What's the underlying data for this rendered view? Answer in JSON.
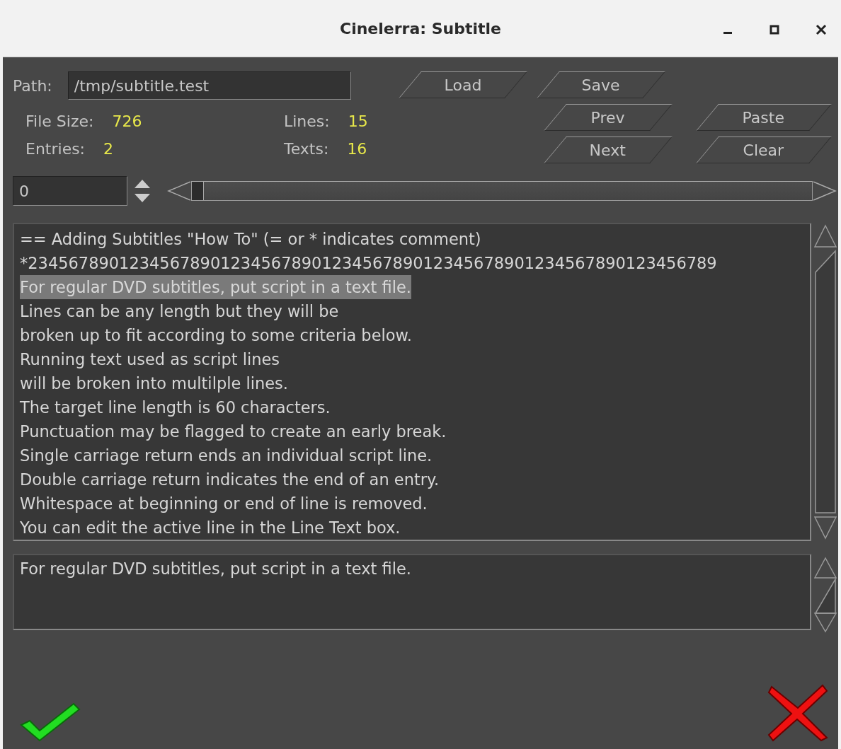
{
  "window": {
    "title": "Cinelerra: Subtitle"
  },
  "path": {
    "label": "Path:",
    "value": "/tmp/subtitle.test"
  },
  "stats": [
    {
      "label": "File Size:",
      "value": "726"
    },
    {
      "label": "Lines:",
      "value": "15"
    },
    {
      "label": "Entries:",
      "value": "2"
    },
    {
      "label": "Texts:",
      "value": "16"
    }
  ],
  "buttons": {
    "load": "Load",
    "save": "Save",
    "prev": "Prev",
    "paste": "Paste",
    "next": "Next",
    "clear": "Clear"
  },
  "position": {
    "value": "0",
    "level": 0
  },
  "script_lines": [
    {
      "text": "== Adding Subtitles \"How To\" (= or * indicates comment)",
      "selected": false
    },
    {
      "text": "*23456789012345678901234567890123456789012345678901234567890123456789",
      "selected": false
    },
    {
      "text": "For regular DVD subtitles, put script in a text file.",
      "selected": true
    },
    {
      "text": "Lines can be any length but they will be",
      "selected": false
    },
    {
      "text": "broken up to fit according to some criteria below.",
      "selected": false
    },
    {
      "text": "Running text used as script lines",
      "selected": false
    },
    {
      "text": "will be broken into multilple lines.",
      "selected": false
    },
    {
      "text": "The target line length is 60 characters.",
      "selected": false
    },
    {
      "text": "Punctuation may be flagged to create an early break.",
      "selected": false
    },
    {
      "text": "Single carriage return ends an individual script line.",
      "selected": false
    },
    {
      "text": "Double carriage return indicates the end of an entry.",
      "selected": false
    },
    {
      "text": "Whitespace at beginning or end of line is removed.",
      "selected": false
    },
    {
      "text": "You can edit the active line in the Line Text box.",
      "selected": false
    }
  ],
  "line_text": {
    "value": "For regular DVD subtitles, put script in a text file."
  }
}
